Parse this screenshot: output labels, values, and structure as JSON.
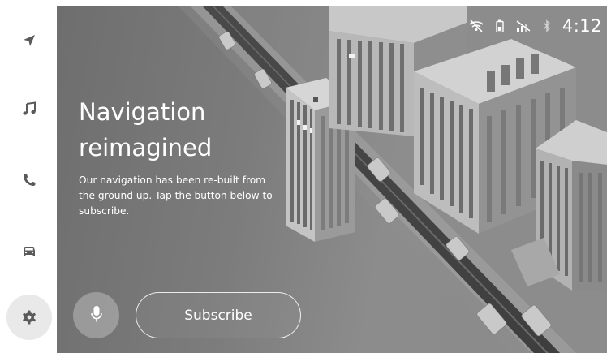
{
  "sidebar": {
    "items": [
      {
        "name": "navigation",
        "icon": "navigation-arrow-icon"
      },
      {
        "name": "music",
        "icon": "music-note-icon"
      },
      {
        "name": "phone",
        "icon": "phone-icon"
      },
      {
        "name": "vehicle",
        "icon": "car-icon"
      },
      {
        "name": "settings",
        "icon": "gear-icon",
        "active": true
      }
    ]
  },
  "status_bar": {
    "icons": [
      "wifi-off-icon",
      "battery-icon",
      "signal-off-icon",
      "bluetooth-icon"
    ],
    "time": "4:12"
  },
  "hero": {
    "title_line1": "Navigation",
    "title_line2": "reimagined",
    "description": "Our navigation has been re-built from the ground up. Tap the button below to subscribe.",
    "subscribe_label": "Subscribe",
    "mic_icon": "microphone-icon"
  },
  "colors": {
    "sidebar_bg": "#ffffff",
    "active_item_bg": "#e9e9e9",
    "icon_color": "#5a5a5a",
    "hero_text": "#ffffff"
  }
}
